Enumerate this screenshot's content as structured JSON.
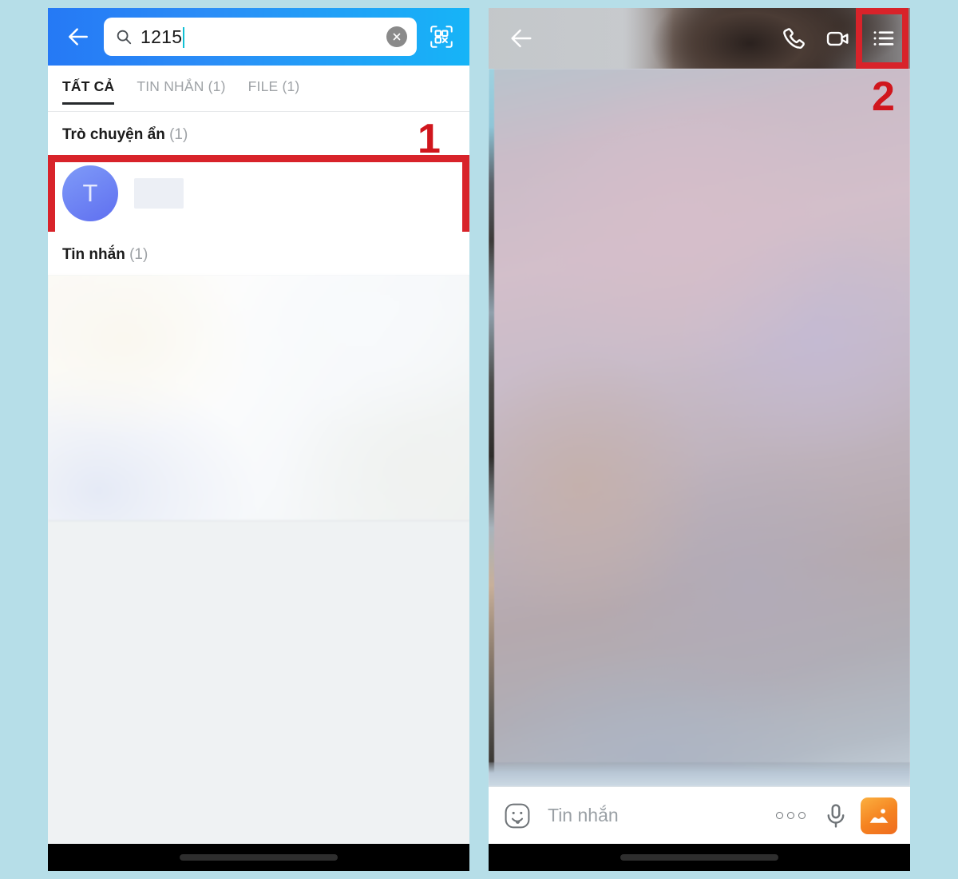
{
  "background_color": "#b6dee8",
  "accent_colors": {
    "header_gradient_start": "#2579f5",
    "header_gradient_end": "#16b4f7",
    "annotation_red": "#d0161d",
    "avatar_gradient_start": "#7f9bf8",
    "avatar_gradient_end": "#5f6ff0",
    "gallery_orange": "#f58220"
  },
  "left_panel": {
    "search": {
      "back_icon": "back-arrow-icon",
      "search_icon": "search-icon",
      "value": "1215",
      "clear_icon": "clear-circle-icon",
      "qr_icon": "qr-scan-icon"
    },
    "tabs": [
      {
        "label": "TẤT CẢ",
        "active": true
      },
      {
        "label": "TIN NHẮN (1)",
        "active": false
      },
      {
        "label": "FILE (1)",
        "active": false
      }
    ],
    "sections": [
      {
        "title": "Trò chuyện ẩn",
        "count": "(1)"
      },
      {
        "title": "Tin nhắn",
        "count": "(1)"
      }
    ],
    "contact": {
      "avatar_initial": "T",
      "name_redacted": true
    }
  },
  "right_panel": {
    "header": {
      "back_icon": "back-arrow-icon",
      "call_icon": "phone-call-icon",
      "video_icon": "video-call-icon",
      "menu_icon": "list-menu-icon"
    },
    "input_bar": {
      "sticker_icon": "smiley-sticker-icon",
      "placeholder": "Tin nhắn",
      "more_icon": "three-dots-icon",
      "mic_icon": "microphone-icon",
      "gallery_icon": "image-gallery-icon"
    }
  },
  "annotations": [
    {
      "label": "1",
      "target": "hidden-chat-result-row"
    },
    {
      "label": "2",
      "target": "chat-menu-button"
    }
  ]
}
